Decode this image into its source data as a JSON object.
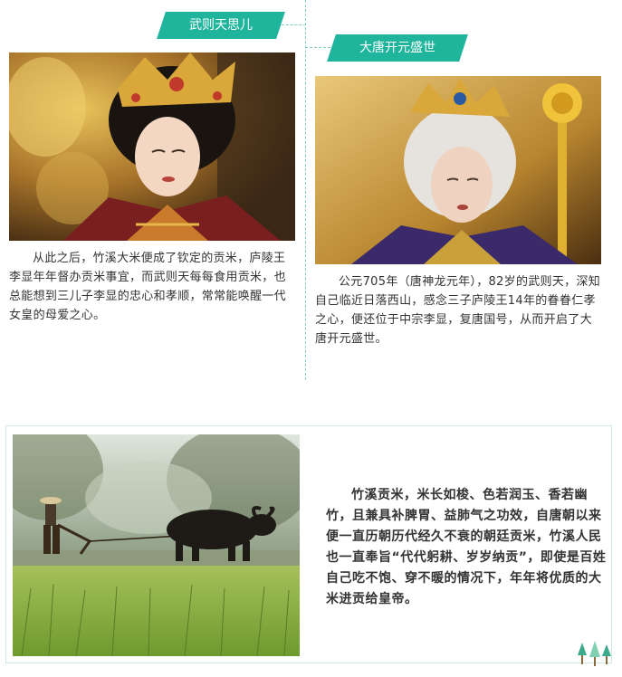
{
  "section_left": {
    "tab_label": "武则天思儿",
    "paragraph": "从此之后，竹溪大米便成了钦定的贡米，庐陵王李显年年督办贡米事宜，而武则天每每食用贡米，也总能想到三儿子李显的忠心和孝顺，常常能唤醒一代女皇的母爱之心。"
  },
  "section_right": {
    "tab_label": "大唐开元盛世",
    "paragraph": "公元705年（唐神龙元年），82岁的武则天，深知自己临近日落西山，感念三子庐陵王14年的眷眷仁孝之心，便还位于中宗李显，复唐国号，从而开启了大唐开元盛世。"
  },
  "section_bottom": {
    "paragraph": "竹溪贡米，米长如梭、色若润玉、香若幽竹，且兼具补脾胃、益肺气之功效，自唐朝以来便一直历朝历代经久不衰的朝廷贡米，竹溪人民也一直奉旨“代代躬耕、岁岁纳贡”，即使是百姓自己吃不饱、穿不暖的情况下，年年将优质的大米进贡给皇帝。"
  },
  "colors": {
    "accent": "#1fb49c",
    "dash": "#7fcfc2",
    "text": "#333333"
  }
}
